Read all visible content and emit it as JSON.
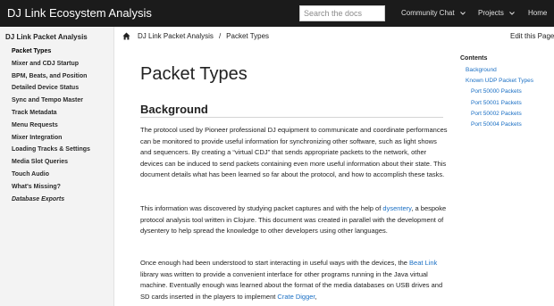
{
  "header": {
    "site_title": "DJ Link Ecosystem Analysis",
    "search_placeholder": "Search the docs",
    "nav": {
      "community_chat": "Community Chat",
      "projects": "Projects",
      "home": "Home"
    },
    "colors": {
      "bar": "#1b1b1b",
      "text": "#ffffff"
    }
  },
  "sidebar": {
    "title": "DJ Link Packet Analysis",
    "items": [
      {
        "label": "Packet Types",
        "active": true
      },
      {
        "label": "Mixer and CDJ Startup"
      },
      {
        "label": "BPM, Beats, and Position"
      },
      {
        "label": "Detailed Device Status"
      },
      {
        "label": "Sync and Tempo Master"
      },
      {
        "label": "Track Metadata"
      },
      {
        "label": "Menu Requests"
      },
      {
        "label": "Mixer Integration"
      },
      {
        "label": "Loading Tracks & Settings"
      },
      {
        "label": "Media Slot Queries"
      },
      {
        "label": "Touch Audio"
      },
      {
        "label": "What's Missing?"
      },
      {
        "label": "Database Exports",
        "italic": true
      }
    ]
  },
  "breadcrumb": {
    "home_icon": "home-icon",
    "items": [
      "DJ Link Packet Analysis",
      "Packet Types"
    ],
    "separator": "/"
  },
  "edit_link": "Edit this Page",
  "main": {
    "title": "Packet Types",
    "section_title": "Background",
    "paragraphs": {
      "p1": "The protocol used by Pioneer professional DJ equipment to communicate and coordinate performances can be monitored to provide useful information for synchronizing other software, such as light shows and sequencers. By creating a “virtual CDJ” that sends appropriate packets to the network, other devices can be induced to send packets containing even more useful information about their state. This document details what has been learned so far about the protocol, and how to accomplish these tasks.",
      "p2_before": "This information was discovered by studying packet captures and with the help of ",
      "p2_link": "dysentery",
      "p2_after": ", a bespoke protocol analysis tool written in Clojure. This document was created in parallel with the development of dysentery to help spread the knowledge to other developers using other languages.",
      "p3_before": "Once enough had been understood to start interacting in useful ways with the devices, the ",
      "p3_link1": "Beat Link",
      "p3_middle": " library was written to provide a convenient interface for other programs running in the Java virtual machine. Eventually enough was learned about the format of the media databases on USB drives and SD cards inserted in the players to implement ",
      "p3_link2": "Crate Digger",
      "p3_after": ","
    },
    "link_color": "#1a6fc4"
  },
  "toc": {
    "title": "Contents",
    "items": [
      {
        "label": "Background",
        "level": 1
      },
      {
        "label": "Known UDP Packet Types",
        "level": 1
      },
      {
        "label": "Port 50000 Packets",
        "level": 2
      },
      {
        "label": "Port 50001 Packets",
        "level": 2
      },
      {
        "label": "Port 50002 Packets",
        "level": 2
      },
      {
        "label": "Port 50004 Packets",
        "level": 2
      }
    ]
  }
}
